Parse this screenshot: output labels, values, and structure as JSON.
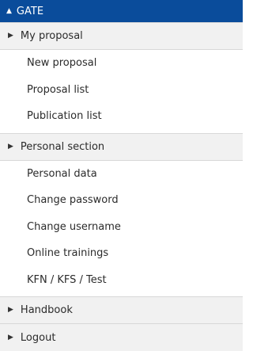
{
  "header": {
    "icon": "triangle-up-icon",
    "label": "GATE"
  },
  "sections": [
    {
      "label": "My proposal",
      "icon": "triangle-right-icon",
      "items": [
        "New proposal",
        "Proposal list",
        "Publication list"
      ]
    },
    {
      "label": "Personal section",
      "icon": "triangle-right-icon",
      "items": [
        "Personal data",
        "Change password",
        "Change username",
        "Online trainings",
        "KFN / KFS / Test"
      ]
    },
    {
      "label": "Handbook",
      "icon": "triangle-right-icon",
      "items": []
    },
    {
      "label": "Logout",
      "icon": "triangle-right-icon",
      "items": []
    }
  ],
  "colors": {
    "header_bg": "#0a4c9b",
    "section_bg": "#f1f1f1",
    "text": "#2b2b2b"
  }
}
